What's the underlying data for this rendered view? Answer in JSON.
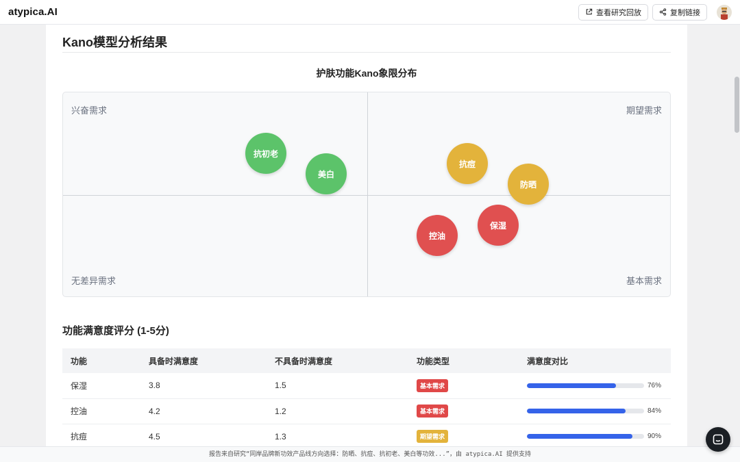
{
  "header": {
    "logo": "atypica.AI",
    "replay_label": "查看研究回放",
    "copy_label": "复制链接"
  },
  "section": {
    "title": "Kano模型分析结果"
  },
  "quadrant_chart": {
    "title": "护肤功能Kano象限分布",
    "labels": {
      "top_left": "兴奋需求",
      "top_right": "期望需求",
      "bottom_left": "无差异需求",
      "bottom_right": "基本需求"
    },
    "items": [
      {
        "label": "抗初老",
        "category": "兴奋需求",
        "color": "#5cc36a"
      },
      {
        "label": "美白",
        "category": "兴奋需求",
        "color": "#5cc36a"
      },
      {
        "label": "抗痘",
        "category": "期望需求",
        "color": "#e3b33b"
      },
      {
        "label": "防晒",
        "category": "期望需求",
        "color": "#e3b33b"
      },
      {
        "label": "保湿",
        "category": "基本需求",
        "color": "#e05050"
      },
      {
        "label": "控油",
        "category": "基本需求",
        "color": "#e05050"
      }
    ]
  },
  "table": {
    "title": "功能满意度评分 (1-5分)",
    "headers": [
      "功能",
      "具备时满意度",
      "不具备时满意度",
      "功能类型",
      "满意度对比"
    ],
    "rows": [
      {
        "feature": "保湿",
        "with": "3.8",
        "without": "1.5",
        "type": "基本需求",
        "type_color": "#e04848",
        "pct": "76%",
        "fill": 0.76
      },
      {
        "feature": "控油",
        "with": "4.2",
        "without": "1.2",
        "type": "基本需求",
        "type_color": "#e04848",
        "pct": "84%",
        "fill": 0.84
      },
      {
        "feature": "抗痘",
        "with": "4.5",
        "without": "1.3",
        "type": "期望需求",
        "type_color": "#e3b33b",
        "pct": "90%",
        "fill": 0.9
      }
    ]
  },
  "footer": {
    "text": "报告来自研究“同岸品牌新功效产品线方向选择：防晒、抗痘、抗初老、美白等功效...”，由 atypica.AI 提供支持"
  },
  "colors": {
    "accent_bar": "#3563e9"
  }
}
